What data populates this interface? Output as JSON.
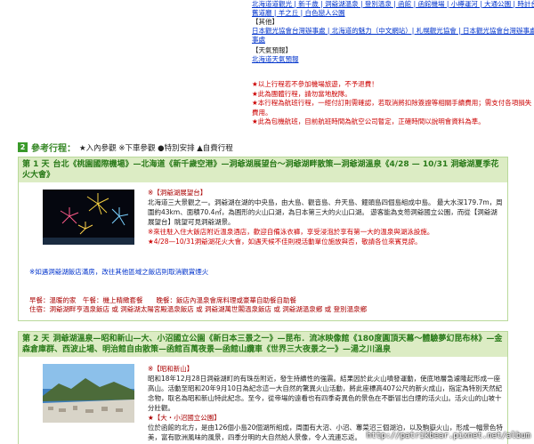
{
  "top_links": {
    "row1": "北海道道觀光 | 新千歲 | 洞爺湖溫泉 | 登別溫泉 | 函館 | 函館機場 | 小樽運河 | 大通公園 | 時計台 | 舊道廳 | 薄野 | 羊之丘展望台",
    "row2": "舊道廳 | 羊之丘 | 白色戀人公園",
    "other_label": "【其他】",
    "row3": "日本觀光協會台灣辦事處 | 北海道的魅力（中文網站）| 札幌觀光協會 | 日本觀光協會台灣辦事處",
    "row4": "事處",
    "weather_label": "【天氣預報】",
    "weather_link": "北海道天氣預報"
  },
  "notes": [
    "★以上行程若不參加機場旅遊，不予退費！",
    "★此為團體行程，請勿當地脫隊。",
    "★本行程為航班行程，一經付訂則需確認，若取消將扣除簽證等相關手續費用；需支付各項損失費用。",
    "★此為包機航班，目前航班時間為航空公司暫定，正確時間以說明會資料為準。"
  ],
  "ref_section": {
    "num": "2",
    "title": "參考行程：",
    "legend": "★入內參觀 ※下車參觀 ●特別安排 ▲自費行程"
  },
  "day1": {
    "day_label": "第 1 天",
    "route": "台北《桃園國際機場》—北海道《新千歲空港》—洞爺湖展望台～洞爺湖畔散策—洞爺湖溫泉《4/28 — 10/31 洞爺湖夏季花火大會》",
    "section_title": "※【洞爺湖展望台】",
    "desc": "北海道三大景觀之一。洞爺湖在湖的中央島，由大島、觀音島、弁天島、饅頭島四個島組成中島。 最大水深179.7m，周圍約43km、面積70.4㎡，為圓形的火山口湖，為日本第三大的火山口湖。 遊客能為支笏洞爺國立公園，而從【洞爺湖展望台】眺望可見洞爺湖景。",
    "desc2": "※來往駐入住大飯店附近溫泉酒店，歡迎自備泳衣褲，享受浸泡於享有第一大的溫泉與湖泳設施。",
    "desc3": "★4/28—10/31洞爺湖花火大會，如遇天候不佳則視活動單位施放與否，敬請各位來賓見諒。",
    "note": "※如遇洞爺湖飯店滿房，改往其他區域之飯店則取消觀賞煙火",
    "meals": "早餐：溫暖的家　午餐：機上精緻套餐　　晚餐：飯店內溫泉會席料理或豪華自助餐自助餐",
    "stay": "住宿：洞爺湖畔亨溫泉飯店 或 洞爺湖太陽宮殿溫泉飯店 或 洞爺湖萬世閣溫泉飯店 或 洞爺湖溫泉鄉 或 登別溫泉鄉"
  },
  "day2": {
    "day_label": "第 2 天",
    "route": "洞爺湖溫泉—昭和新山—大、小沼國立公園《新日本三景之一》—昆布．流冰映像館《180度圓頂天幕～體驗夢幻昆布林》—金森倉庫群、西波止場、明治館自由散策—函館百萬夜景—函館山纜車《世界三大夜景之一》—湯之川溫泉",
    "section_title": "※【昭和新山】",
    "desc": "昭和18年12月28日洞爺湖町的有珠岳附近，發生持續性的強震。結果因於此火山噴發運動，使底地層急遽隆起形成一座高山。活動至昭和20年9月10日為紀念這一大自然的驚異火山活動，將此座標高407公尺的新火成山，指定為特別天然紀念物，取名為昭和新山特此紀念。至今，從帝場的遠看也有四季奇異色的景色在不斷冒出白煙的活火山。活火山的山坡十分壯觀。",
    "section2": "★【大・小沼國立公園】",
    "desc2": "位於函館的北方，是由126個小島20個湖所組成，周圍有大沼、小沼、蓴菜沼三個湖泊，以及駒嶽火山，形成一幅景色特美，富有歐洲風味的風景，四季分明的大自然給人景像，令人流連忘返。"
  },
  "watermark": "http://patrikbear.pixnet.net/album"
}
